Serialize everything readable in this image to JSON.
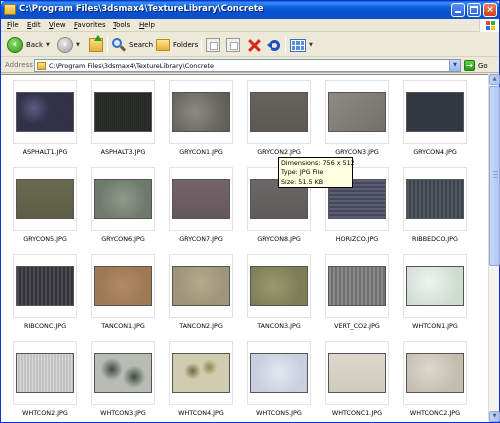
{
  "window": {
    "title": "C:\\Program Files\\3dsmax4\\TextureLibrary\\Concrete"
  },
  "menu": [
    "File",
    "Edit",
    "View",
    "Favorites",
    "Tools",
    "Help"
  ],
  "toolbar": {
    "back_label": "Back",
    "search_label": "Search",
    "folders_label": "Folders"
  },
  "address": {
    "label": "Address",
    "value": "C:\\Program Files\\3dsmax4\\TextureLibrary\\Concrete",
    "go_label": "Go"
  },
  "files": [
    {
      "name": "ASPHALT1.JPG",
      "texture": "asphalt1"
    },
    {
      "name": "ASPHALT3.JPG",
      "texture": "asphalt3"
    },
    {
      "name": "GRYCON1.JPG",
      "texture": "grycon1"
    },
    {
      "name": "GRYCON2.JPG",
      "texture": "grycon2"
    },
    {
      "name": "GRYCON3.JPG",
      "texture": "grycon3"
    },
    {
      "name": "GRYCON4.JPG",
      "texture": "grycon4"
    },
    {
      "name": "GRYCON5.JPG",
      "texture": "grycon5"
    },
    {
      "name": "GRYCON6.JPG",
      "texture": "grycon6"
    },
    {
      "name": "GRYCON7.JPG",
      "texture": "grycon7"
    },
    {
      "name": "GRYCON8.JPG",
      "texture": "grycon8"
    },
    {
      "name": "HORIZCO.JPG",
      "texture": "horizco"
    },
    {
      "name": "RIBBEDCO.JPG",
      "texture": "ribbedco"
    },
    {
      "name": "RIBCONC.JPG",
      "texture": "ribconc"
    },
    {
      "name": "TANCON1.JPG",
      "texture": "tancon1"
    },
    {
      "name": "TANCON2.JPG",
      "texture": "tancon2"
    },
    {
      "name": "TANCON3.JPG",
      "texture": "tancon3"
    },
    {
      "name": "VERT_CO2.JPG",
      "texture": "vertco2"
    },
    {
      "name": "WHTCON1.JPG",
      "texture": "whtcon1"
    },
    {
      "name": "WHTCON2.JPG",
      "texture": "whtcon2"
    },
    {
      "name": "WHTCON3.JPG",
      "texture": "whtcon3"
    },
    {
      "name": "WHTCON4.JPG",
      "texture": "whtcon4"
    },
    {
      "name": "WHTCON5.JPG",
      "texture": "whtcon5"
    },
    {
      "name": "WHTCONC1.JPG",
      "texture": "whtconc1"
    },
    {
      "name": "WHTCONC2.JPG",
      "texture": "whtconc2"
    }
  ],
  "tooltip": {
    "dimensions": "Dimensions: 756 x 512",
    "type": "Type: JPG File",
    "size": "Size: 51.5 KB"
  },
  "colors": {
    "titlebar": "#0a5fd8",
    "window_border": "#0831d9",
    "tooltip_bg": "#ffffe1"
  }
}
